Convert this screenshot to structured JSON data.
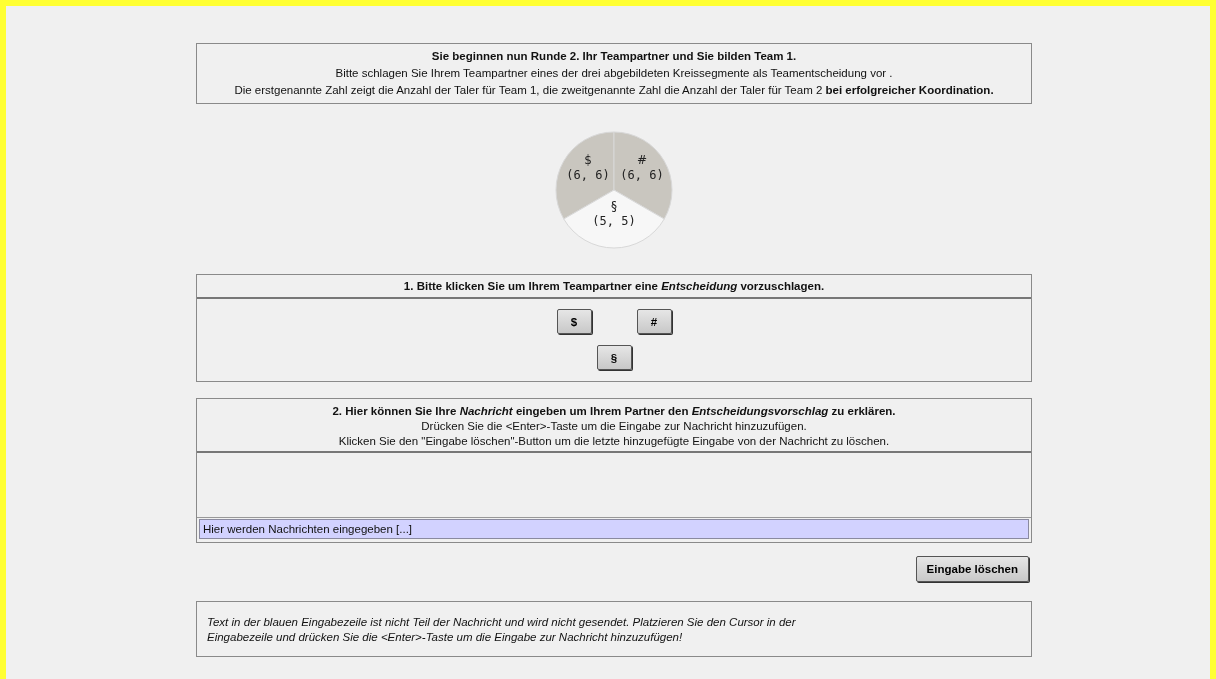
{
  "intro": {
    "title": "Sie beginnen nun Runde 2. Ihr Teampartner und Sie bilden Team 1.",
    "lines": [
      "Bitte schlagen Sie Ihrem Teampartner eines der drei abgebildeten Kreissegmente als Teamentscheidung vor .",
      "Die erstgenannte Zahl zeigt die Anzahl der Taler für Team 1, die zweitgenannte Zahl die Anzahl der Taler für Team 2 **bei erfolgreicher Koordination.**"
    ]
  },
  "pie": [
    {
      "symbol": "$",
      "payoff": "(6, 6)",
      "color": "#c9c6bf"
    },
    {
      "symbol": "#",
      "payoff": "(6, 6)",
      "color": "#c9c6bf"
    },
    {
      "symbol": "§",
      "payoff": "(5, 5)",
      "color": "#f7f7f7"
    }
  ],
  "decision": {
    "title": "1. Bitte klicken Sie um Ihrem Teampartner eine *Entscheidung* vorzuschlagen.",
    "buttons": [
      "$",
      "#",
      "§"
    ]
  },
  "message": {
    "title": "2.  Hier können Sie Ihre *Nachricht* eingeben um Ihrem Partner den *Entscheidungsvorschlag* zu erklären.",
    "lines": [
      "Drücken Sie die <Enter>-Taste um die Eingabe zur Nachricht hinzuzufügen.",
      "Klicken Sie den \"Eingabe löschen\"-Button um die letzte hinzugefügte Eingabe von der Nachricht zu löschen."
    ],
    "input": "Hier werden Nachrichten eingegeben [...]"
  },
  "delete_button": "Eingabe löschen",
  "note": "Text in der blauen Eingabezeile ist nicht Teil der Nachricht und wird nicht gesendet. Platzieren Sie den Cursor in der Eingabezeile und drücken Sie die <Enter>-Taste um die Eingabe zur Nachricht hinzuzufügen!"
}
